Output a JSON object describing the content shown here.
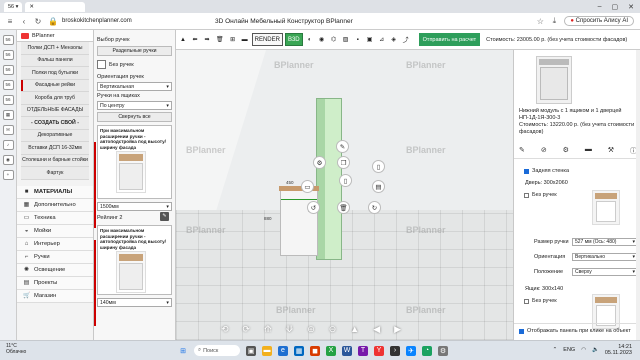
{
  "browser": {
    "tab_count": "56",
    "url": "broskokitchenplanner.com",
    "page_title": "3D Онлайн Мебельный Конструктор BPlanner",
    "alisa_label": "Спросить Алису AI",
    "sidebar_badges": [
      "56",
      "56",
      "56",
      "56",
      "56"
    ]
  },
  "left_panel": {
    "brand": "BPlanner",
    "items": [
      "Полки ДСП + Мензолы",
      "Фальш панели",
      "Полки под бутылки",
      "Фасадные рейки",
      "Короба для труб",
      "ОТДЕЛЬНЫЕ ФАСАДЫ",
      "- СОЗДАТЬ СВОЙ -",
      "Декоративные",
      "Вставки ДСП 16-32мм",
      "Столешни и барные стойки",
      "Фартук"
    ],
    "sections": [
      {
        "label": "МАТЕРИАЛЫ",
        "icon": "■"
      },
      {
        "label": "Дополнительно",
        "icon": "▦"
      },
      {
        "label": "Техника",
        "icon": "▭"
      },
      {
        "label": "Мойки",
        "icon": "◒"
      },
      {
        "label": "Интерьер",
        "icon": "⌂"
      },
      {
        "label": "Ручки",
        "icon": "⌐"
      },
      {
        "label": "Освещение",
        "icon": "✺"
      },
      {
        "label": "Проекты",
        "icon": "▤"
      },
      {
        "label": "Магазин",
        "icon": "🛒"
      }
    ]
  },
  "options_panel": {
    "title": "Выбор ручек",
    "sep_handles_btn": "Раздельные ручки",
    "no_handles": "Без ручек",
    "orientation_label": "Ориентация ручек",
    "orientation_value": "Вертикальная",
    "align_label": "Ручки на ящиках",
    "align_value": "По центру",
    "collapse_btn": "Свернуть все",
    "card_title": "При максимальном расширении ручки - автоподстройка под высоту/ширину фасада",
    "size1": "1500мм",
    "rail_label": "Рейлинг 2",
    "size2": "140мм"
  },
  "toolbar": {
    "render_label": "RENDER",
    "b3d_label": "B3D",
    "send_label": "Отправить на расчет",
    "cost_text": "Стоимость: 23005.00 р. (без учета стоимости фасадов)"
  },
  "viewport": {
    "watermark": "BPlanner",
    "dim_450": "450",
    "dim_880": "880",
    "dim_130": "130"
  },
  "right_panel": {
    "desc_line1": "Нижний модуль с 1 ящиком и 1 дверцей",
    "desc_line2": "НП-1Д-1Я-300-3",
    "desc_line3": "Стоимость: 13220.00 р. (без учета стоимости фасадов)",
    "back_wall": "Задняя стенка",
    "door_label": "Дверь: 300х2060",
    "no_handles": "Без ручек",
    "handle_size_label": "Размер ручки",
    "handle_size_value": "527 мм (Ось: 480)",
    "orientation_label": "Ориентация",
    "orientation_value": "Вертикально",
    "position_label": "Положение",
    "position_value": "Сверху",
    "drawer_label": "Ящик: 300х140",
    "no_handles2": "Без ручек",
    "show_panel": "Отображать панель при клике на объект"
  },
  "taskbar": {
    "temp": "11°C",
    "weather": "Облачно",
    "search_placeholder": "Поиск",
    "lang": "ENG",
    "time": "14:21",
    "date": "05.11.2023"
  }
}
